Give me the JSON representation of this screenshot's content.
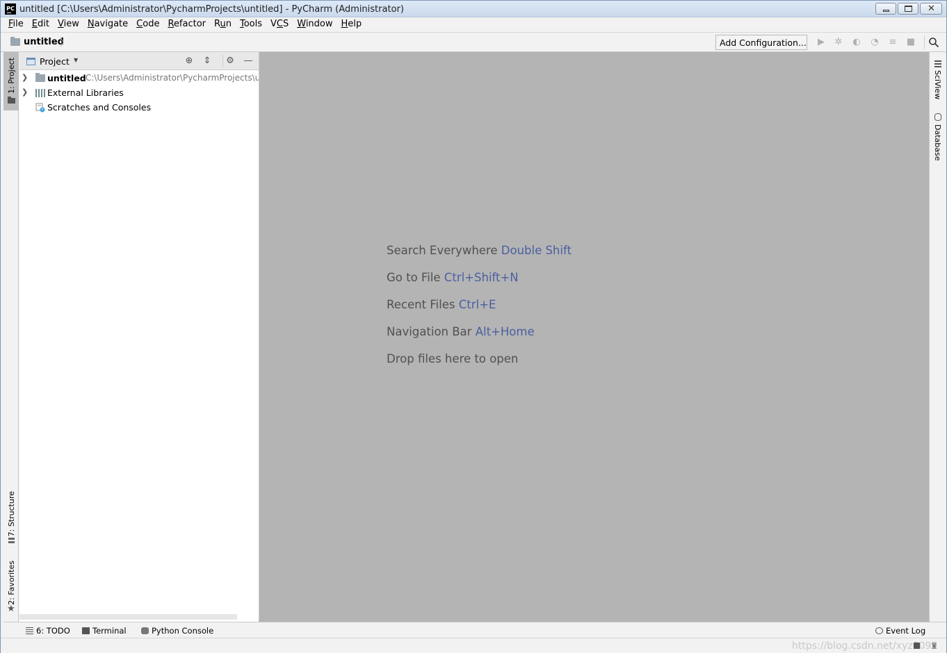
{
  "window": {
    "title": "untitled [C:\\Users\\Administrator\\PycharmProjects\\untitled] - PyCharm (Administrator)",
    "app_icon_text": "PC"
  },
  "menu": [
    {
      "label": "File",
      "mnemonic": "F",
      "rest": "ile"
    },
    {
      "label": "Edit",
      "mnemonic": "E",
      "rest": "dit"
    },
    {
      "label": "View",
      "mnemonic": "V",
      "rest": "iew"
    },
    {
      "label": "Navigate",
      "mnemonic": "N",
      "rest": "avigate"
    },
    {
      "label": "Code",
      "mnemonic": "C",
      "rest": "ode"
    },
    {
      "label": "Refactor",
      "mnemonic": "R",
      "rest": "efactor"
    },
    {
      "label": "Run",
      "mnemonic": "R",
      "rest": "un",
      "underline_index": 1
    },
    {
      "label": "Tools",
      "mnemonic": "T",
      "rest": "ools"
    },
    {
      "label": "VCS",
      "mnemonic": "",
      "rest": "VCS",
      "underline_index": 1
    },
    {
      "label": "Window",
      "mnemonic": "W",
      "rest": "indow"
    },
    {
      "label": "Help",
      "mnemonic": "H",
      "rest": "elp"
    }
  ],
  "navbar": {
    "breadcrumb": "untitled",
    "add_configuration": "Add Configuration..."
  },
  "left_strip": {
    "project_tab": "1: Project",
    "structure_tab": "7: Structure",
    "favorites_tab": "2: Favorites"
  },
  "project_panel": {
    "title": "Project",
    "tree": [
      {
        "label": "untitled",
        "path": "C:\\Users\\Administrator\\PycharmProjects\\untitled",
        "bold": true,
        "expandable": true,
        "icon": "folder-icon"
      },
      {
        "label": "External Libraries",
        "expandable": true,
        "icon": "library-icon"
      },
      {
        "label": "Scratches and Consoles",
        "expandable": false,
        "icon": "scratch-icon"
      }
    ]
  },
  "editor_hints": [
    {
      "text": "Search Everywhere",
      "shortcut": "Double Shift"
    },
    {
      "text": "Go to File",
      "shortcut": "Ctrl+Shift+N"
    },
    {
      "text": "Recent Files",
      "shortcut": "Ctrl+E"
    },
    {
      "text": "Navigation Bar",
      "shortcut": "Alt+Home"
    },
    {
      "text": "Drop files here to open",
      "shortcut": ""
    }
  ],
  "right_strip": {
    "sciview_tab": "SciView",
    "database_tab": "Database"
  },
  "bottom_tools": {
    "todo": "6: TODO",
    "terminal": "Terminal",
    "python_console": "Python Console",
    "event_log": "Event Log"
  },
  "status": {
    "watermark": "https://blog.csdn.net/xyz0099"
  },
  "colors": {
    "editor_bg": "#b4b4b4",
    "shortcut_color": "#4a5fa0",
    "hint_color": "#505050"
  }
}
